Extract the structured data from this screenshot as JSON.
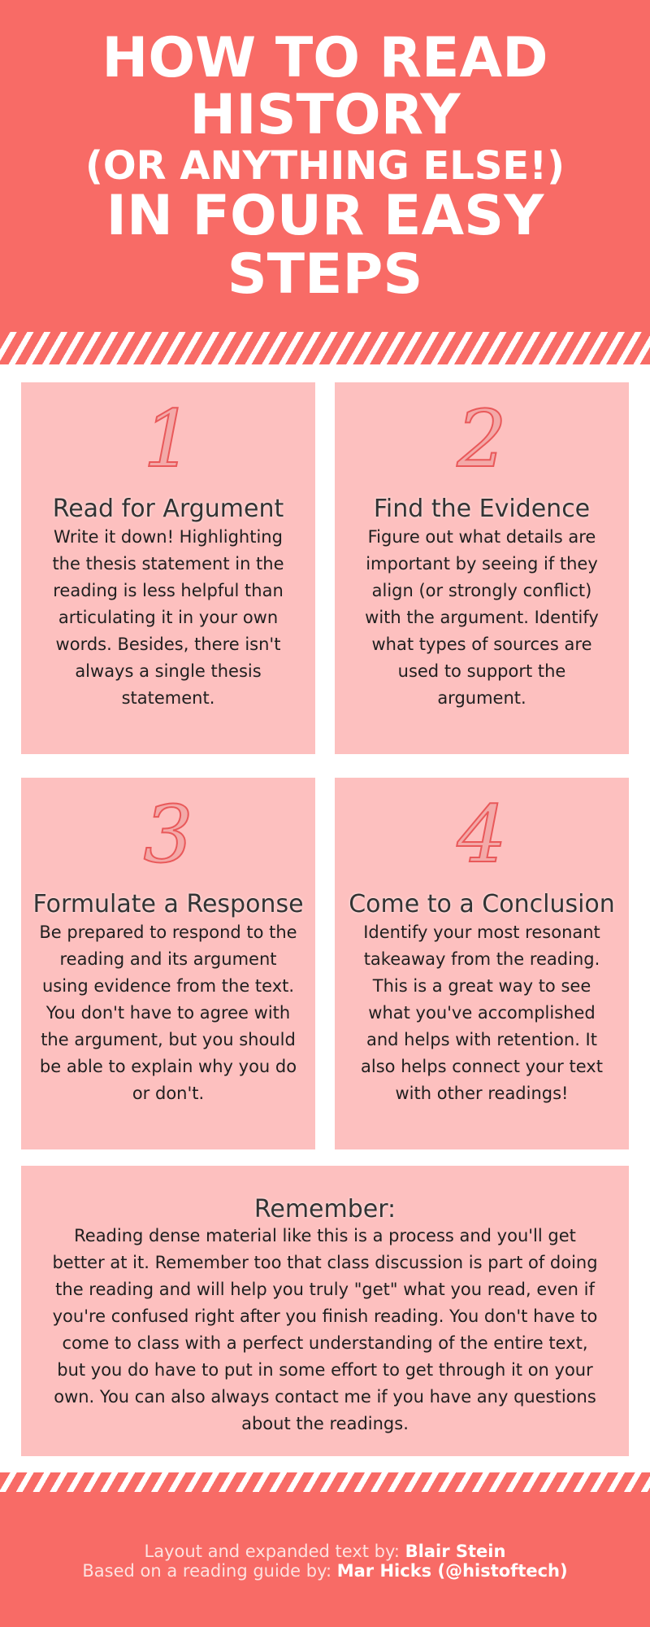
{
  "header": {
    "title_line1": "HOW TO READ",
    "title_line2": "HISTORY",
    "title_line3": "(OR ANYTHING ELSE!)",
    "title_line4": "IN FOUR EASY",
    "title_line5": "STEPS"
  },
  "steps": [
    {
      "number": "1",
      "title": "Read for Argument",
      "body": "Write it down! Highlighting the thesis statement in the reading is less helpful than articulating it in your own words. Besides, there isn't always a single thesis statement."
    },
    {
      "number": "2",
      "title": "Find the Evidence",
      "body": "Figure out what details are important by seeing if they align (or strongly conflict) with the argument. Identify what types of sources are used to support the argument."
    },
    {
      "number": "3",
      "title": "Formulate a Response",
      "body": "Be prepared to respond to the reading and its argument using evidence from the text. You don't have to agree with the argument, but you should be able to explain why you do or don't."
    },
    {
      "number": "4",
      "title": "Come to a Conclusion",
      "body": "Identify your most resonant takeaway from the reading. This is a great way to see what you've accomplished and helps with retention. It also helps connect your text with other readings!"
    }
  ],
  "remember": {
    "title": "Remember:",
    "body": "Reading dense material like this is a process and you'll get better at it. Remember too that class discussion is part of doing the reading and will help you truly \"get\" what you read, even if you're confused right after you finish reading. You don't have to come to class with a perfect understanding of the entire text, but you do have to put in some effort to get through it on your own. You can also always contact me if you have any questions about the readings."
  },
  "footer": {
    "credit1_label": "Layout and expanded text by: ",
    "credit1_name": "Blair Stein",
    "credit2_label": "Based on a reading guide by: ",
    "credit2_name": "Mar Hicks (@histoftech)"
  },
  "colors": {
    "header_bg": "#f86b66",
    "card_bg": "#fdc0bf",
    "number_stroke": "#e9595a"
  }
}
